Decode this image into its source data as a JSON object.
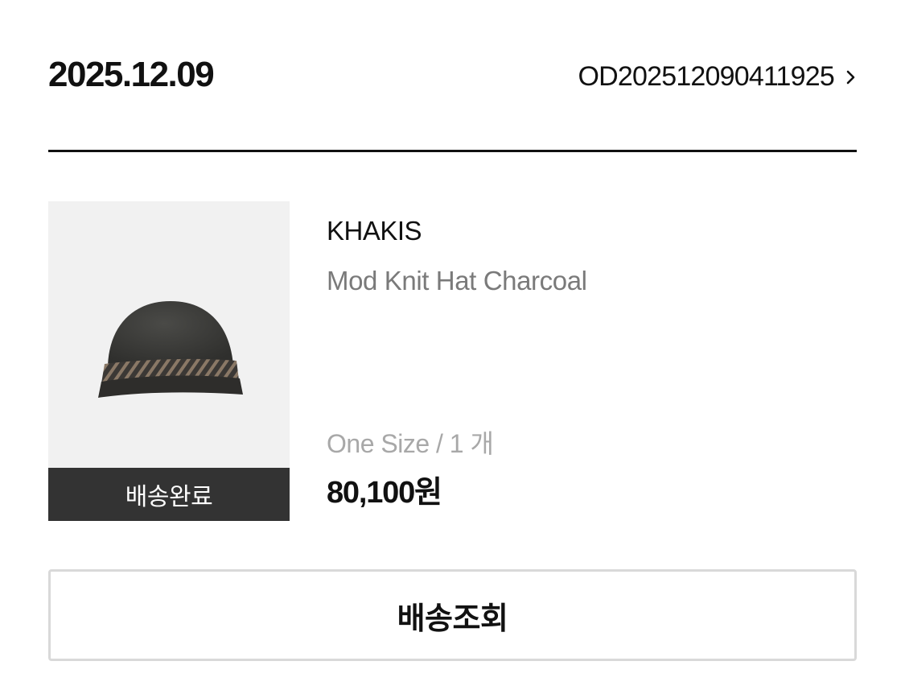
{
  "order": {
    "date": "2025.12.09",
    "number": "OD202512090411925"
  },
  "icons": {
    "detail": "chevron-right-icon",
    "product": "beanie-hat-image"
  },
  "product": {
    "status": "배송완료",
    "brand": "KHAKIS",
    "name": "Mod Knit Hat Charcoal",
    "option": "One Size / 1 개",
    "price": "80,100원"
  },
  "actions": {
    "track_label": "배송조회"
  },
  "colors": {
    "status_bar_bg": "#333333",
    "status_text": "#ffffff",
    "primary_text": "#111111",
    "secondary_text": "#7a7a7a",
    "muted_text": "#a8a8a8",
    "divider": "#111111",
    "button_border": "#d9d9d9",
    "thumbnail_bg": "#f1f1f1"
  }
}
